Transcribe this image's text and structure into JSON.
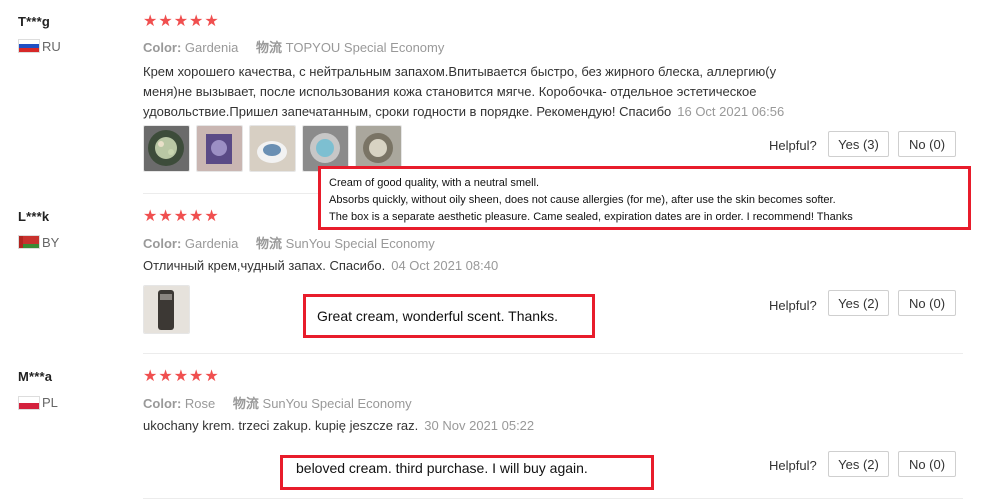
{
  "reviews": [
    {
      "user": "T***g",
      "country": "RU",
      "stars": "★★★★★",
      "color_label": "Color:",
      "color_value": "Gardenia",
      "ship_label": "物流",
      "ship_value": "TOPYOU Special Economy",
      "text": "Крем хорошего качества, с нейтральным запахом.Впитывается быстро, без жирного блеска, аллергию(у меня)не вызывает, после использования кожа становится мягче. Коробочка- отдельное эстетическое удовольствие.Пришел запечатанным, сроки годности в порядке. Рекомендую! Спасибо",
      "date": "16 Oct 2021 06:56",
      "helpful_label": "Helpful?",
      "yes_label": "Yes (3)",
      "no_label": "No (0)"
    },
    {
      "user": "L***k",
      "country": "BY",
      "stars": "★★★★★",
      "color_label": "Color:",
      "color_value": "Gardenia",
      "ship_label": "物流",
      "ship_value": "SunYou Special Economy",
      "text": "Отличный крем,чудный запах. Спасибо.",
      "date": "04 Oct 2021 08:40",
      "helpful_label": "Helpful?",
      "yes_label": "Yes (2)",
      "no_label": "No (0)"
    },
    {
      "user": "M***a",
      "country": "PL",
      "stars": "★★★★★",
      "color_label": "Color:",
      "color_value": "Rose",
      "ship_label": "物流",
      "ship_value": "SunYou Special Economy",
      "text": "ukochany krem. trzeci zakup. kupię jeszcze raz.",
      "date": "30 Nov 2021 05:22",
      "helpful_label": "Helpful?",
      "yes_label": "Yes (2)",
      "no_label": "No (0)"
    }
  ],
  "translations": {
    "review1": [
      "Cream of good quality, with a neutral smell.",
      "Absorbs quickly, without oily sheen, does not cause allergies (for me), after use the skin becomes softer.",
      "The box is a separate aesthetic pleasure. Came sealed, expiration dates are in order. I recommend! Thanks"
    ],
    "review2": "Great cream, wonderful scent. Thanks.",
    "review3": "beloved cream. third purchase. I will buy again."
  },
  "colors": {
    "star": "#f04f4f",
    "callout_border": "#e81c2b",
    "muted": "#999999"
  }
}
